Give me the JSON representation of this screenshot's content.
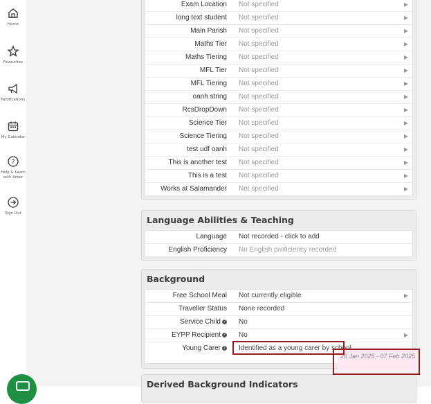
{
  "nav": {
    "items": [
      {
        "label": "Home",
        "icon": "home-icon"
      },
      {
        "label": "Favourites",
        "icon": "star-icon"
      },
      {
        "label": "Notifications",
        "icon": "megaphone-icon"
      },
      {
        "label": "My Calendar",
        "icon": "calendar-icon"
      },
      {
        "label": "Help & Learn",
        "label2": "with Arbor",
        "icon": "help-icon"
      },
      {
        "label": "Sign Out",
        "icon": "sign-out-icon"
      }
    ]
  },
  "udf_panel": {
    "rows": [
      {
        "label": "Exam Location",
        "value": "Not specified"
      },
      {
        "label": "long text student",
        "value": "Not specified"
      },
      {
        "label": "Main Parish",
        "value": "Not specified"
      },
      {
        "label": "Maths Tier",
        "value": "Not specified"
      },
      {
        "label": "Maths Tiering",
        "value": "Not specified"
      },
      {
        "label": "MFL Tier",
        "value": "Not specified"
      },
      {
        "label": "MFL Tiering",
        "value": "Not specified"
      },
      {
        "label": "oanh string",
        "value": "Not specified"
      },
      {
        "label": "RcsDropDown",
        "value": "Not specified"
      },
      {
        "label": "Science Tier",
        "value": "Not specified"
      },
      {
        "label": "Science Tiering",
        "value": "Not specified"
      },
      {
        "label": "test udf oanh",
        "value": "Not specified"
      },
      {
        "label": "This is another test",
        "value": "Not specified"
      },
      {
        "label": "This is a test",
        "value": "Not specified"
      },
      {
        "label": "Works at Salamander",
        "value": "Not specified"
      }
    ]
  },
  "language_panel": {
    "title": "Language Abilities & Teaching",
    "rows": [
      {
        "label": "Language",
        "value": "Not recorded - click to add"
      },
      {
        "label": "English Proficiency",
        "value": "No English proficiency recorded"
      }
    ]
  },
  "background_panel": {
    "title": "Background",
    "rows": [
      {
        "label": "Free School Meal",
        "value": "Not currently eligible"
      },
      {
        "label": "Traveller Status",
        "value": "None recorded"
      },
      {
        "label": "Service Child",
        "value": "No"
      },
      {
        "label": "EYPP Recipient",
        "value": "No"
      },
      {
        "label": "Young Carer",
        "value": "Identified as a young carer by school",
        "date_range": "26 Jan 2025 - 07 Feb 2025"
      }
    ]
  },
  "derived_panel": {
    "title": "Derived Background Indicators"
  },
  "help_glyph": "?",
  "arrow_glyph": "▶",
  "colors": {
    "highlight": "#9a1b1b",
    "fab": "#1f8f43"
  }
}
